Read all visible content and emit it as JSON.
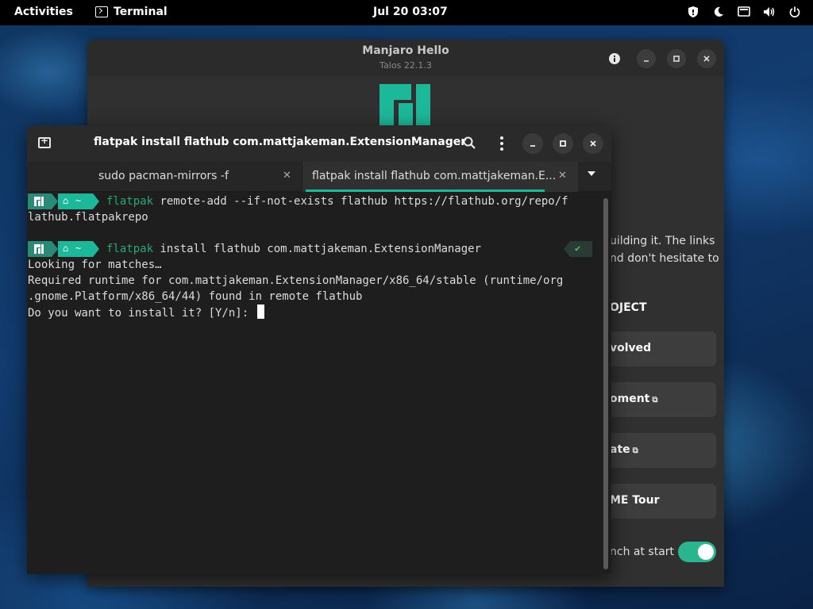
{
  "topbar": {
    "activities": "Activities",
    "app_name": "Terminal",
    "clock": "Jul 20  03:07"
  },
  "hello": {
    "title": "Manjaro Hello",
    "subtitle": "Talos 22.1.3",
    "text_line1": "uilding it. The links",
    "text_line2": "nd don't hesitate to",
    "section_heading": "OJECT",
    "buttons": [
      {
        "label": "volved",
        "external": false
      },
      {
        "label": "oment",
        "external": true
      },
      {
        "label": "ate",
        "external": true
      },
      {
        "label": "ME Tour",
        "external": false
      }
    ],
    "launch_label": "nch at start",
    "launch_enabled": true,
    "accent_color": "#1db899"
  },
  "terminal": {
    "title": "flatpak install flathub com.mattjakeman.ExtensionManager",
    "tabs": [
      {
        "label": "sudo pacman-mirrors -f",
        "active": false
      },
      {
        "label": "flatpak install flathub com.mattjakeman.E...",
        "active": true
      }
    ],
    "prompt_dir": "~",
    "lines": {
      "cmd1_keyword": "flatpak",
      "cmd1_rest": " remote-add --if-not-exists flathub https://flathub.org/repo/f",
      "cmd1_wrap": "lathub.flatpakrepo",
      "cmd2_keyword": "flatpak",
      "cmd2_rest": " install flathub com.mattjakeman.ExtensionManager",
      "cmd2_status": "✔",
      "out1": "Looking for matches…",
      "out2": "Required runtime for com.mattjakeman.ExtensionManager/x86_64/stable (runtime/org",
      "out3": ".gnome.Platform/x86_64/44) found in remote flathub",
      "out4": "Do you want to install it? [Y/n]: "
    }
  }
}
